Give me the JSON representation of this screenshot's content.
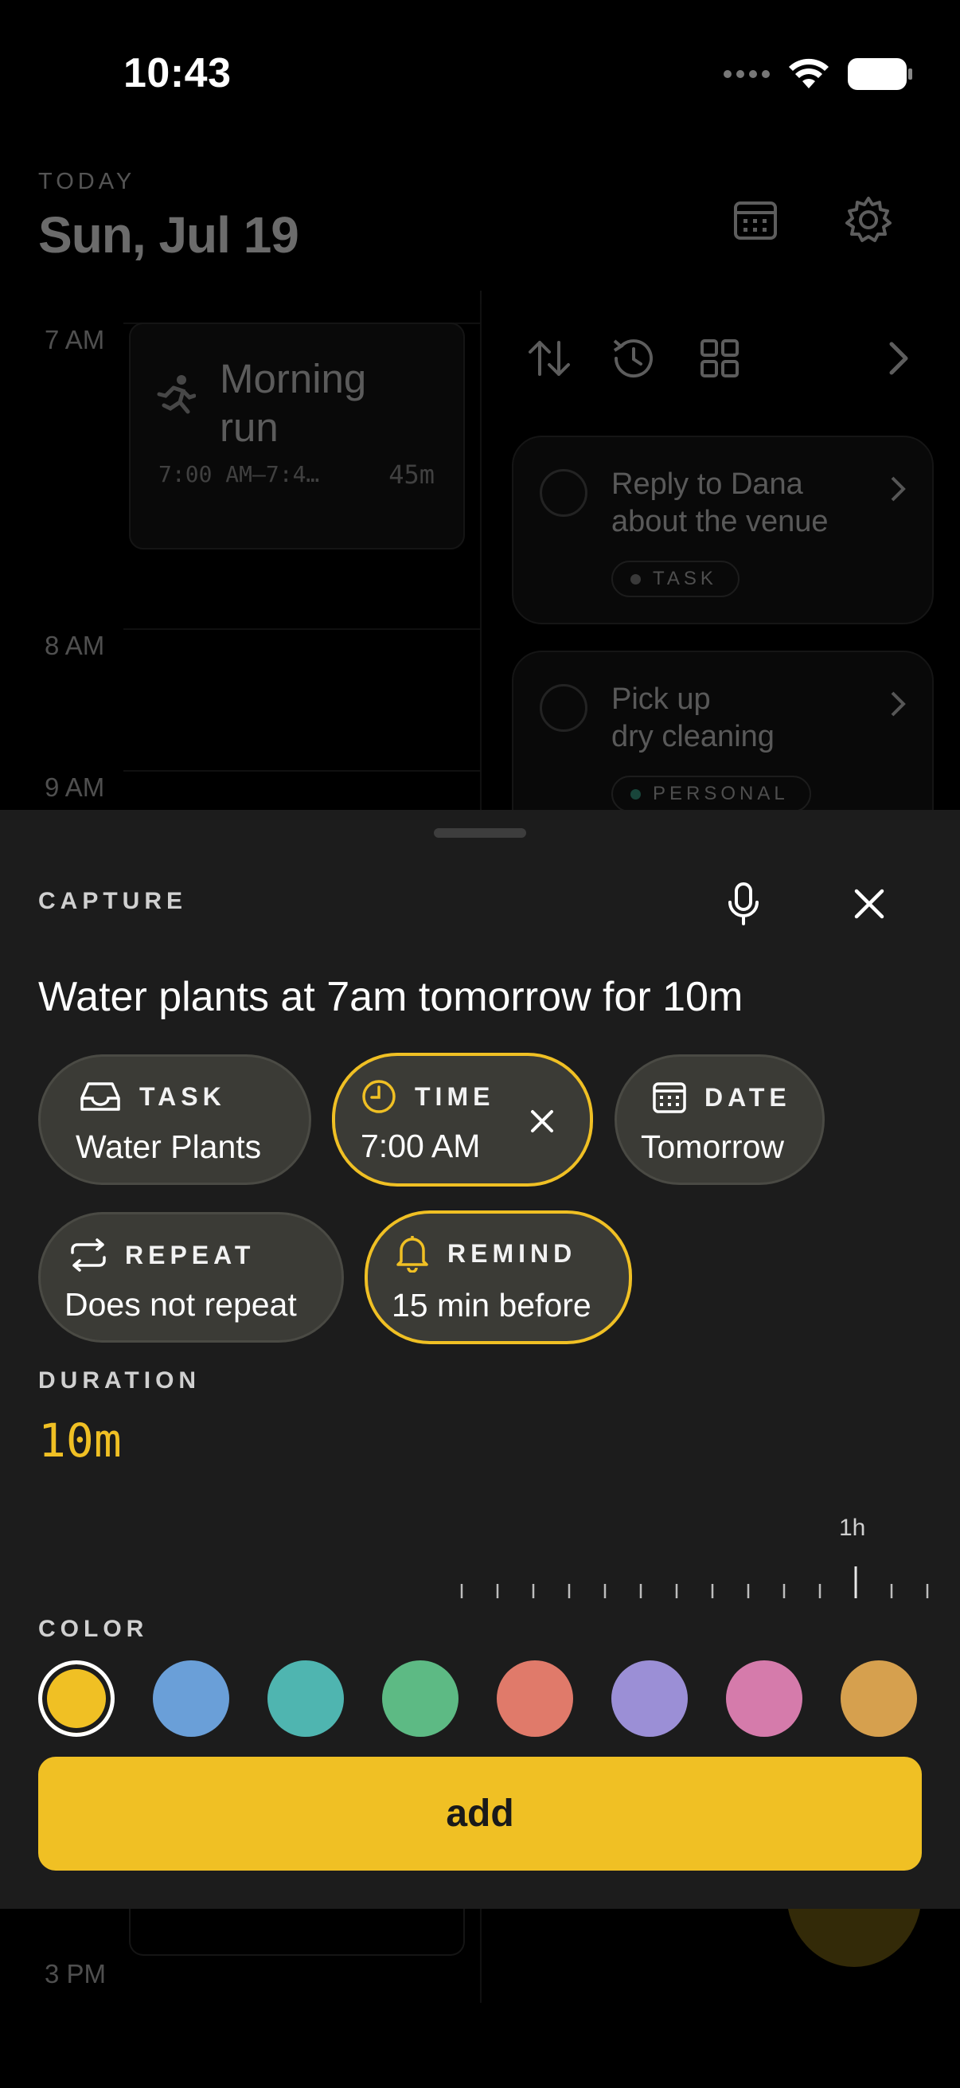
{
  "status_bar": {
    "time": "10:43"
  },
  "header": {
    "today_label": "TODAY",
    "date": "Sun, Jul 19"
  },
  "timeline": {
    "hours": [
      "7 AM",
      "8 AM",
      "9 AM",
      "3 PM"
    ],
    "event": {
      "title": "Morning run",
      "time_range": "7:00 AM—7:4…",
      "duration": "45m",
      "icon": "running-icon"
    }
  },
  "tasks": [
    {
      "title": "Reply to Dana about the venue",
      "line1": "Reply to Dana",
      "line2": "about the venue",
      "tag": "TASK",
      "tag_color": "#8a8a8a"
    },
    {
      "title": "Pick up dry cleaning",
      "line1": "Pick up",
      "line2": "dry cleaning",
      "tag": "PERSONAL",
      "tag_color": "#3aa58a"
    }
  ],
  "sheet": {
    "label": "CAPTURE",
    "input_text": "Water plants at 7am tomorrow for 10m",
    "chips": {
      "task": {
        "label": "TASK",
        "value": "Water Plants",
        "icon": "inbox-icon"
      },
      "time": {
        "label": "TIME",
        "value": "7:00 AM",
        "icon": "clock-icon"
      },
      "date": {
        "label": "DATE",
        "value": "Tomorrow",
        "icon": "calendar-icon"
      },
      "repeat": {
        "label": "REPEAT",
        "value": "Does not repeat",
        "icon": "repeat-icon"
      },
      "remind": {
        "label": "REMIND",
        "value": "15 min before",
        "icon": "bell-icon"
      }
    },
    "duration": {
      "label": "DURATION",
      "value": "10m",
      "ruler_mark": "1h"
    },
    "color": {
      "label": "COLOR",
      "swatches": [
        "#f0c024",
        "#6a9fd8",
        "#4fb5b0",
        "#5dba84",
        "#e07a6a",
        "#9b8fd6",
        "#d57bab",
        "#d6a04e"
      ],
      "selected": "#f0c024"
    },
    "add_label": "add"
  },
  "colors": {
    "accent": "#f0c024",
    "sheet_bg": "#1c1c1c",
    "chip_bg": "#3b3b36"
  }
}
